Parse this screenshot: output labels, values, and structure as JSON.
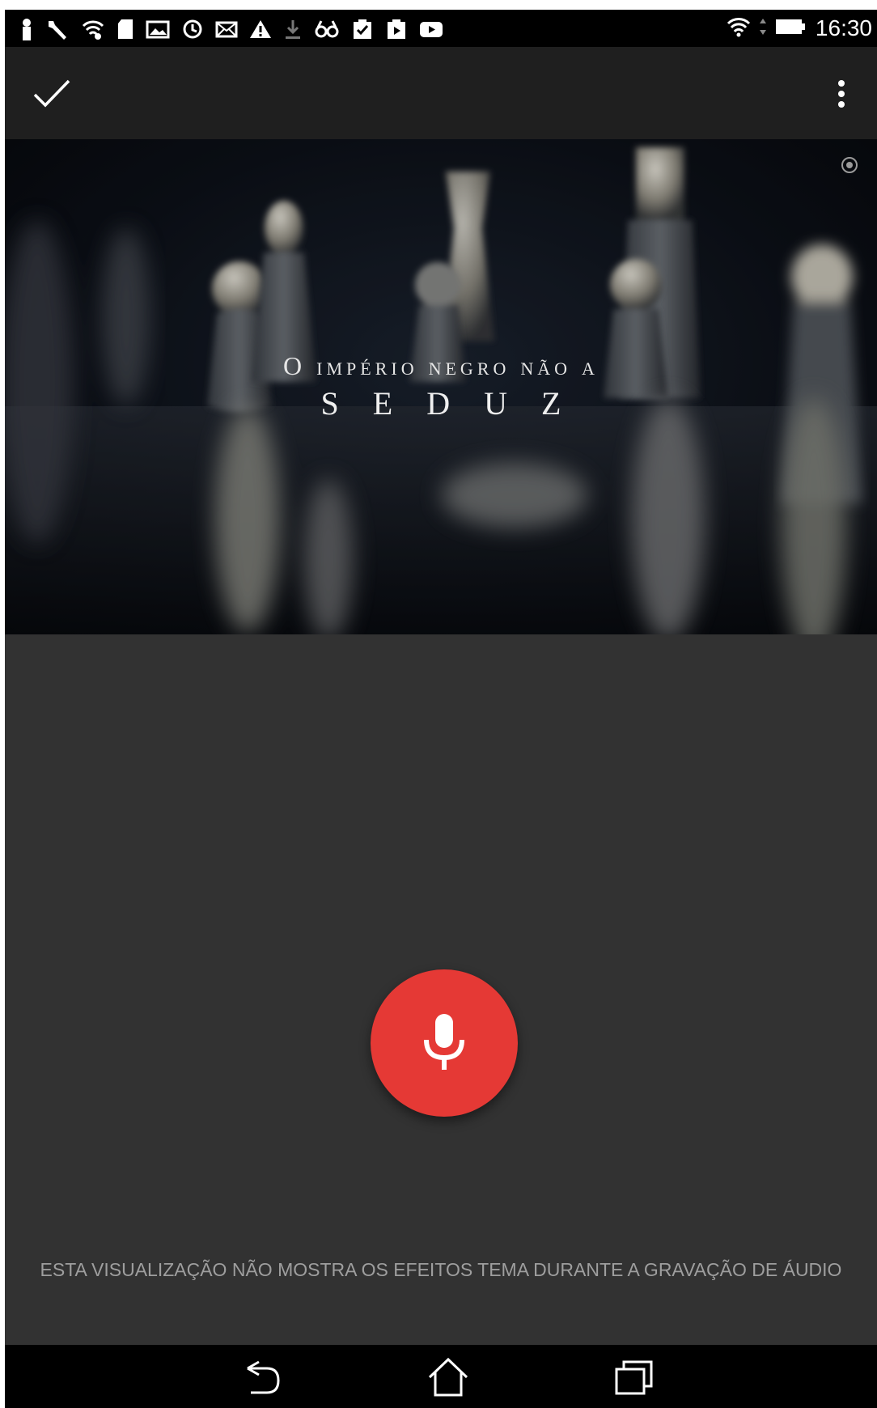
{
  "status_bar": {
    "time": "16:30",
    "left_icons": [
      "person-icon",
      "wrench-icon",
      "wifi-icon",
      "sd-card-icon",
      "photo-icon",
      "sync-icon",
      "mail-icon",
      "warning-icon",
      "download-icon",
      "glasses-icon",
      "clipboard-check-icon",
      "clipboard-play-icon",
      "youtube-icon"
    ],
    "right_icons": [
      "wifi-icon",
      "data-arrows-icon",
      "battery-icon"
    ]
  },
  "action_bar": {
    "done_icon": "check-icon",
    "menu_icon": "more-vert-icon"
  },
  "preview": {
    "line1": "O império negro não a",
    "line2": "SEDUZ"
  },
  "record": {
    "mic_icon": "microphone-icon",
    "accent_color": "#e53935",
    "notice": "ESTA VISUALIZAÇÃO NÃO MOSTRA OS EFEITOS TEMA DURANTE A GRAVAÇÃO DE ÁUDIO"
  },
  "nav_bar": {
    "icons": [
      "back-icon",
      "home-icon",
      "recents-icon"
    ]
  }
}
